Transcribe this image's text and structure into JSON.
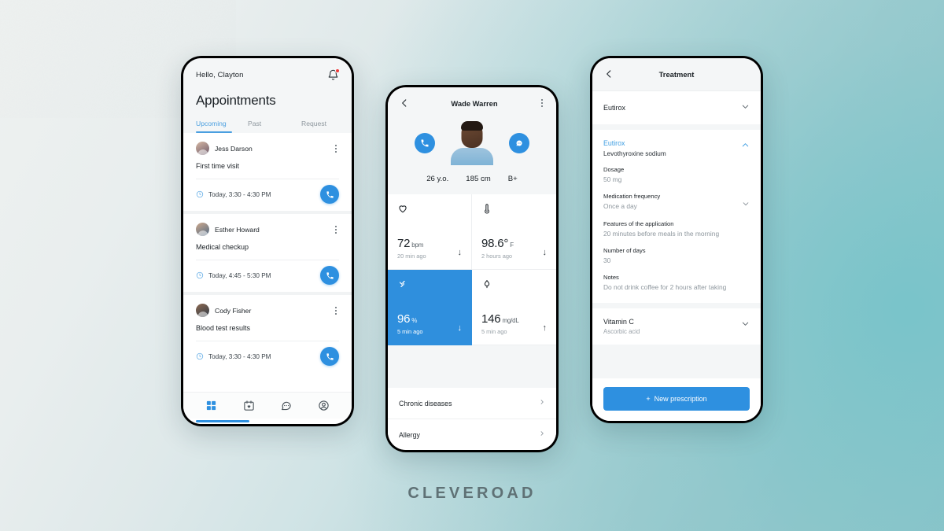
{
  "brand": {
    "wordmark": "CLEVEROAD"
  },
  "theme": {
    "accent": "#2e90e0",
    "tab_active": "#4a9fe0",
    "link": "#3f9ee2",
    "badge": "#ef3b3b",
    "screen_bg": "#f4f6f7"
  },
  "phone1": {
    "greeting": "Hello, Clayton",
    "bell_icon": "bell-icon",
    "title": "Appointments",
    "tabs": [
      {
        "label": "Upcoming",
        "active": true
      },
      {
        "label": "Past",
        "active": false
      },
      {
        "label": "Request",
        "active": false
      }
    ],
    "appointments": [
      {
        "name": "Jess Darson",
        "reason": "First time visit",
        "time": "Today, 3:30 - 4:30 PM",
        "call_icon": "phone-icon",
        "menu_icon": "kebab-menu-icon",
        "clock_icon": "clock-icon"
      },
      {
        "name": "Esther Howard",
        "reason": "Medical checkup",
        "time": "Today, 4:45 - 5:30 PM",
        "call_icon": "phone-icon",
        "menu_icon": "kebab-menu-icon",
        "clock_icon": "clock-icon"
      },
      {
        "name": "Cody Fisher",
        "reason": "Blood test results",
        "time": "Today, 3:30 - 4:30 PM",
        "call_icon": "phone-icon",
        "menu_icon": "kebab-menu-icon",
        "clock_icon": "clock-icon"
      }
    ],
    "nav": [
      {
        "icon": "grid-dashboard-icon",
        "active": true
      },
      {
        "icon": "calendar-heart-icon",
        "active": false
      },
      {
        "icon": "chat-bubble-icon",
        "active": false
      },
      {
        "icon": "profile-icon",
        "active": false
      }
    ]
  },
  "phone2": {
    "back_icon": "back-chevron-icon",
    "title": "Wade Warren",
    "menu_icon": "kebab-menu-icon",
    "call_action_icon": "phone-icon",
    "message_action_icon": "chat-bubble-icon",
    "avatar": "patient-photo",
    "stats": [
      {
        "value": "26 y.o."
      },
      {
        "value": "185 cm"
      },
      {
        "value": "B+"
      }
    ],
    "vitals": [
      {
        "icon": "heart-icon",
        "value": "72",
        "unit": "bpm",
        "ago": "20 min ago",
        "trend": "↓",
        "highlight": false
      },
      {
        "icon": "thermometer-icon",
        "value": "98.6°",
        "unit": "F",
        "ago": "2 hours ago",
        "trend": "↓",
        "highlight": false
      },
      {
        "icon": "oxygen-saturation-icon",
        "value": "96",
        "unit": "%",
        "ago": "5 min ago",
        "trend": "↓",
        "highlight": true
      },
      {
        "icon": "blood-drop-icon",
        "value": "146",
        "unit": "mg/dL",
        "ago": "5 min ago",
        "trend": "↑",
        "highlight": false
      }
    ],
    "rows": [
      {
        "label": "Chronic diseases",
        "chevron": "chevron-right-icon"
      },
      {
        "label": "Allergy",
        "chevron": "chevron-right-icon"
      }
    ]
  },
  "phone3": {
    "back_icon": "back-chevron-icon",
    "title": "Treatment",
    "collapsed_medication": {
      "name": "Eutirox",
      "chevron": "chevron-down-icon"
    },
    "medication": {
      "name": "Eutirox",
      "generic": "Levothyroxine sodium",
      "collapse_icon": "chevron-up-icon",
      "fields": [
        {
          "label": "Dosage",
          "value": "50 mg",
          "chevron": null
        },
        {
          "label": "Medication frequency",
          "value": "Once a day",
          "chevron": "chevron-down-icon"
        },
        {
          "label": "Features of the application",
          "value": "20 minutes before meals in the morning",
          "chevron": null
        },
        {
          "label": "Number of days",
          "value": "30",
          "chevron": null
        },
        {
          "label": "Notes",
          "value": "Do not drink coffee for 2 hours after taking",
          "chevron": null
        }
      ]
    },
    "second_medication": {
      "name": "Vitamin C",
      "generic": "Ascorbic acid",
      "chevron": "chevron-down-icon"
    },
    "new_prescription_button": {
      "label": "New prescription",
      "icon": "plus-icon"
    }
  }
}
